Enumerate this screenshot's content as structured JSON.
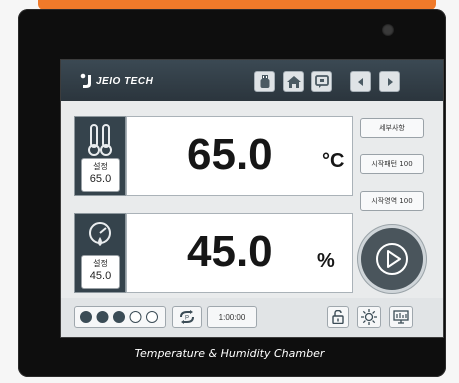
{
  "brand": {
    "logo_text": "JEIO TECH"
  },
  "nav": {
    "icons": [
      "usb-icon",
      "home-icon",
      "message-icon",
      "arrow-left-icon",
      "arrow-right-icon"
    ]
  },
  "temperature": {
    "set_label": "설정",
    "set_value": "65.0",
    "current_value": "65.0",
    "unit": "°C"
  },
  "humidity": {
    "set_label": "설정",
    "set_value": "45.0",
    "current_value": "45.0",
    "unit": "%"
  },
  "side_buttons": {
    "details": "세부사항",
    "start_pattern": "시작패턴 100",
    "start_area": "시작영역 100"
  },
  "status": {
    "level_dots": {
      "filled": 3,
      "total": 5
    },
    "timer": "1:00:00"
  },
  "caption": "Temperature & Humidity Chamber",
  "colors": {
    "accent_orange": "#f07a2a",
    "header_dark": "#35434c",
    "screen_bg": "#e9ebec"
  }
}
